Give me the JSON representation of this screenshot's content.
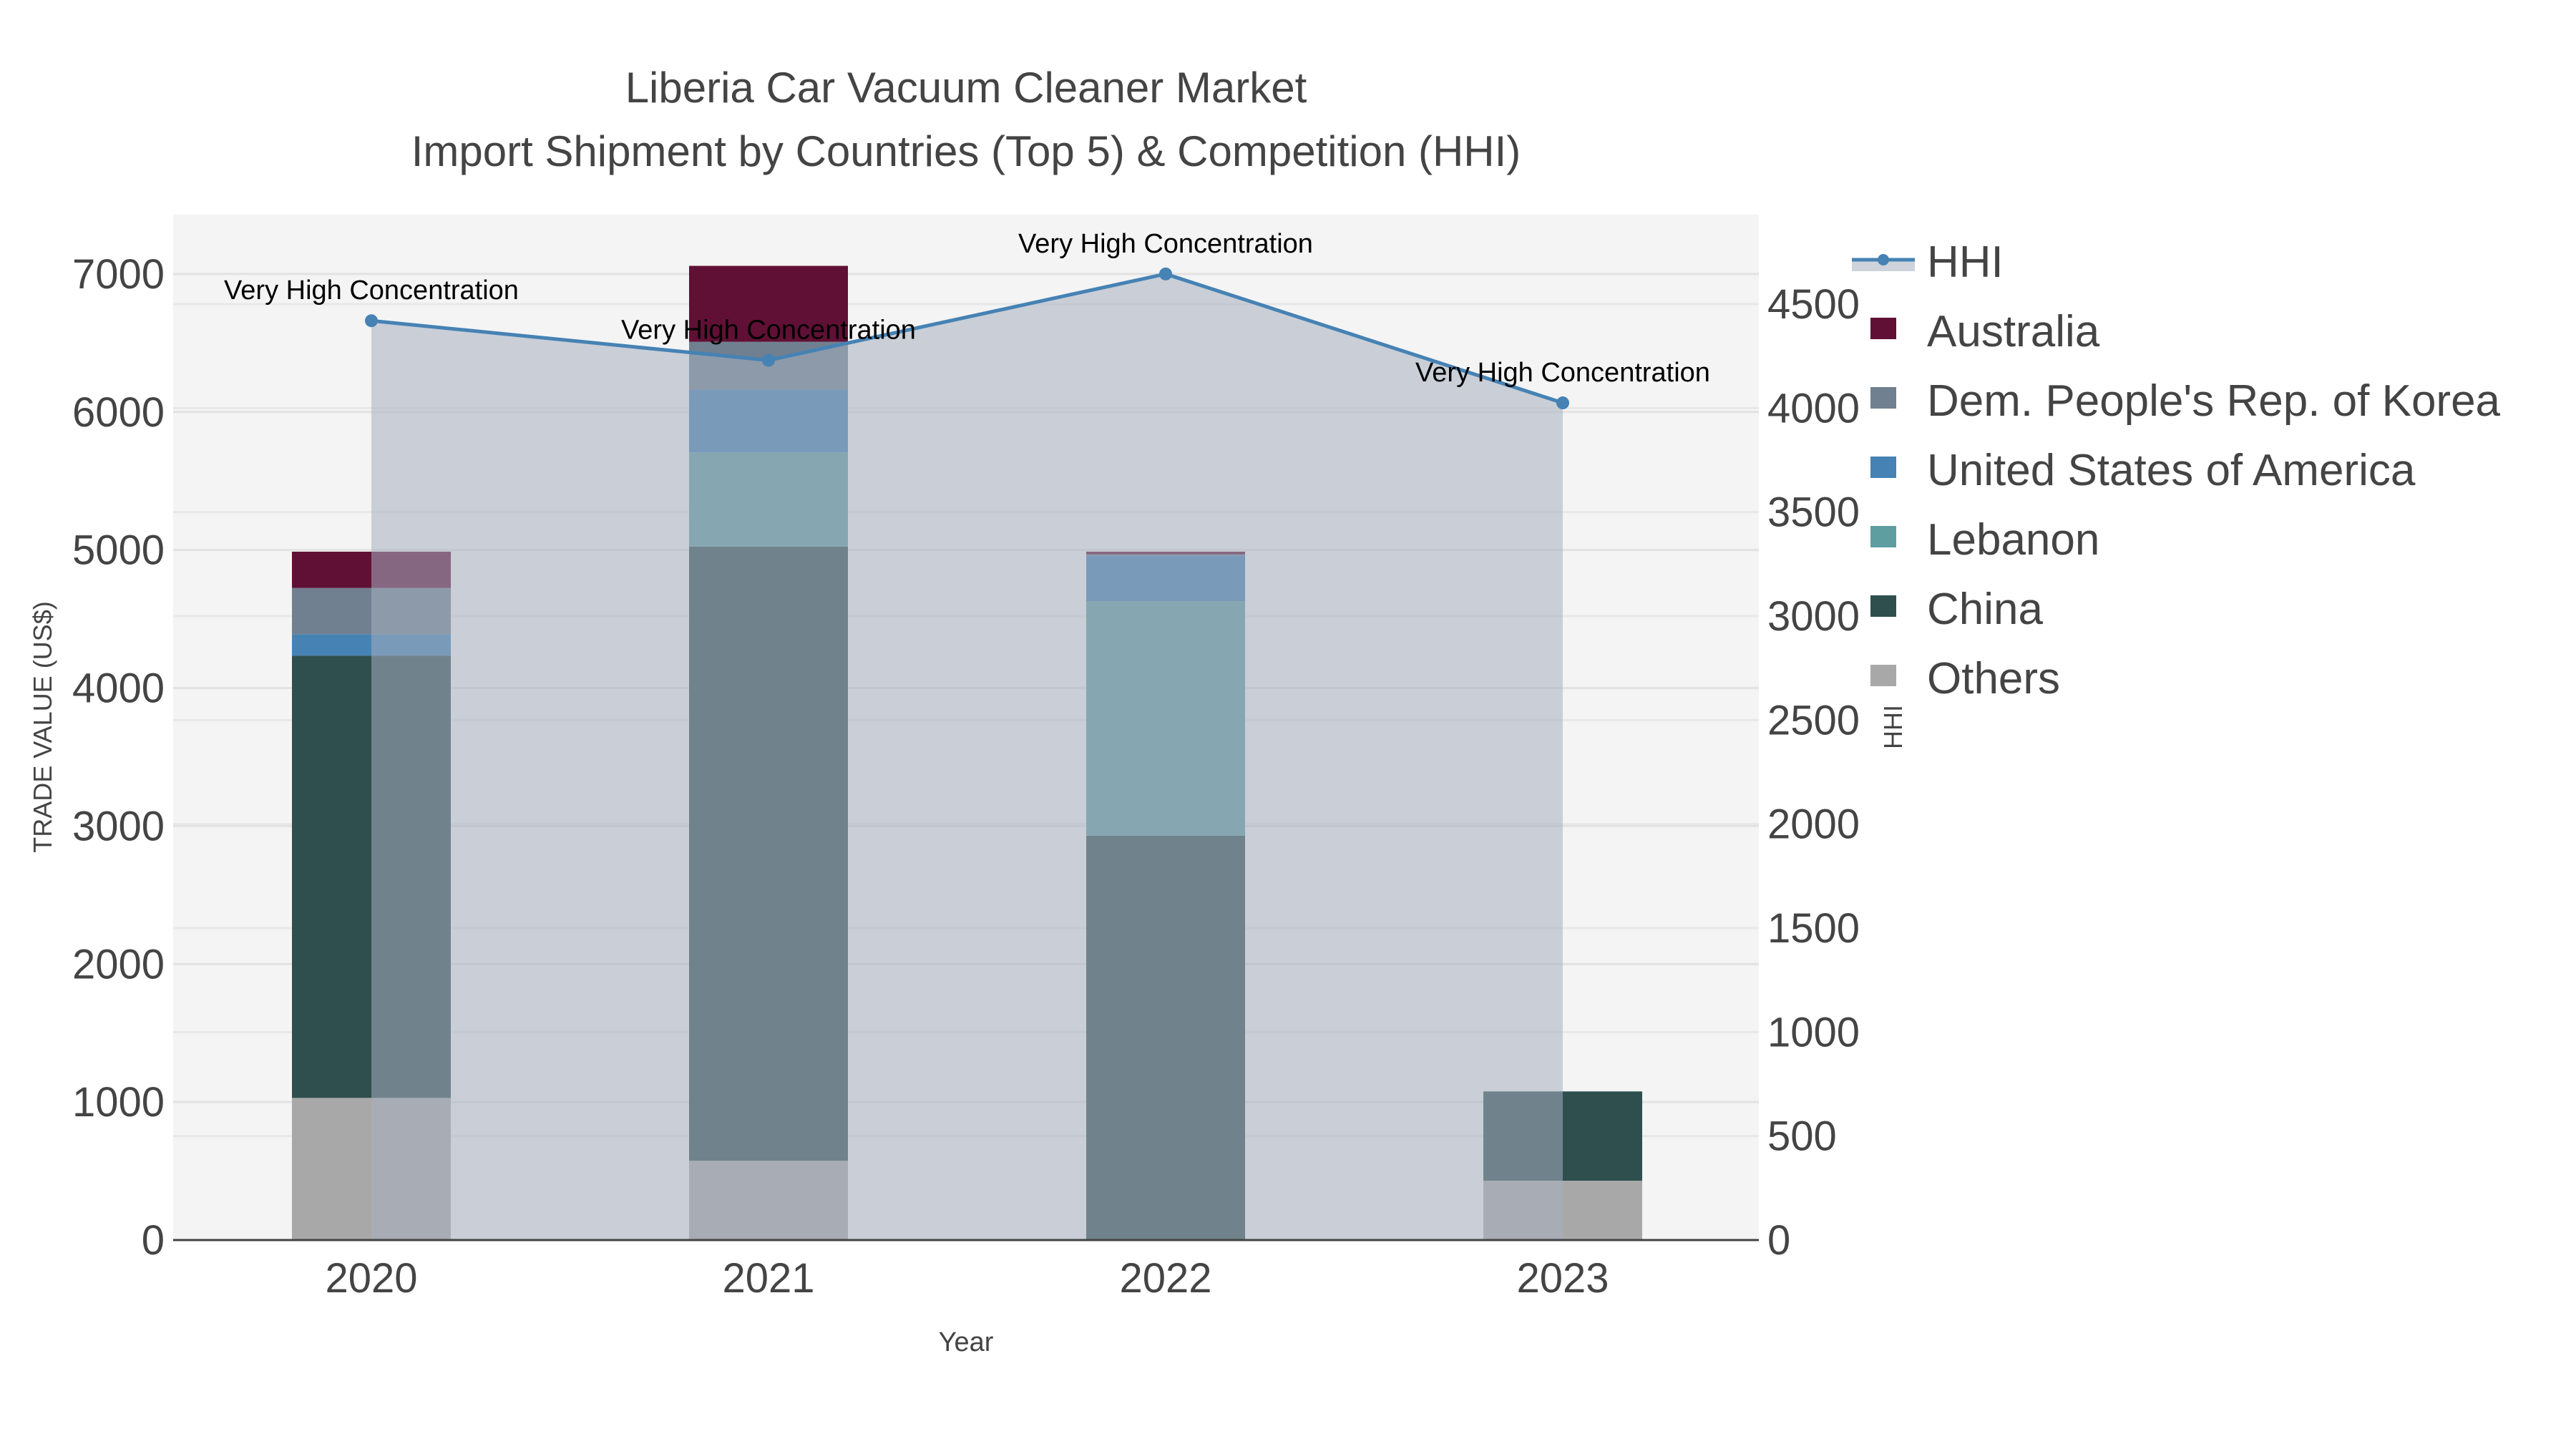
{
  "chart_data": {
    "type": "bar",
    "title": "Liberia Car Vacuum Cleaner Market",
    "subtitle": "Import Shipment by Countries (Top 5) & Competition (HHI)",
    "xlabel": "Year",
    "ylabel": "TRADE VALUE (US$)",
    "y2label": "HHI",
    "categories": [
      "2020",
      "2021",
      "2022",
      "2023"
    ],
    "ylim": [
      0,
      7430
    ],
    "y2lim": [
      0,
      4930
    ],
    "yticks": [
      0,
      1000,
      2000,
      3000,
      4000,
      5000,
      6000,
      7000
    ],
    "y2ticks": [
      0,
      500,
      1000,
      1500,
      2000,
      2500,
      3000,
      3500,
      4000,
      4500
    ],
    "grid": true,
    "legend_position": "right",
    "series": [
      {
        "name": "Others",
        "color": "#a8a8a8",
        "values": [
          1030,
          575,
          5,
          430
        ]
      },
      {
        "name": "China",
        "color": "#2f4f4f",
        "values": [
          3205,
          4450,
          2925,
          647
        ]
      },
      {
        "name": "Lebanon",
        "color": "#5f9ea0",
        "values": [
          0,
          682,
          1700,
          0
        ]
      },
      {
        "name": "United States of America",
        "color": "#4682b4",
        "values": [
          155,
          455,
          330,
          0
        ]
      },
      {
        "name": "Dem. People's Rep. of Korea",
        "color": "#708090",
        "values": [
          335,
          347,
          8,
          0
        ]
      },
      {
        "name": "Australia",
        "color": "#601035",
        "values": [
          263,
          550,
          20,
          0
        ]
      }
    ],
    "hhi": {
      "name": "HHI",
      "color": "#4682b4",
      "values": [
        4420,
        4230,
        4645,
        4025
      ],
      "annotations": [
        "Very High Concentration",
        "Very High Concentration",
        "Very High Concentration",
        "Very High Concentration"
      ]
    },
    "legend_order": [
      "HHI",
      "Australia",
      "Dem. People's Rep. of Korea",
      "United States of America",
      "Lebanon",
      "China",
      "Others"
    ]
  }
}
